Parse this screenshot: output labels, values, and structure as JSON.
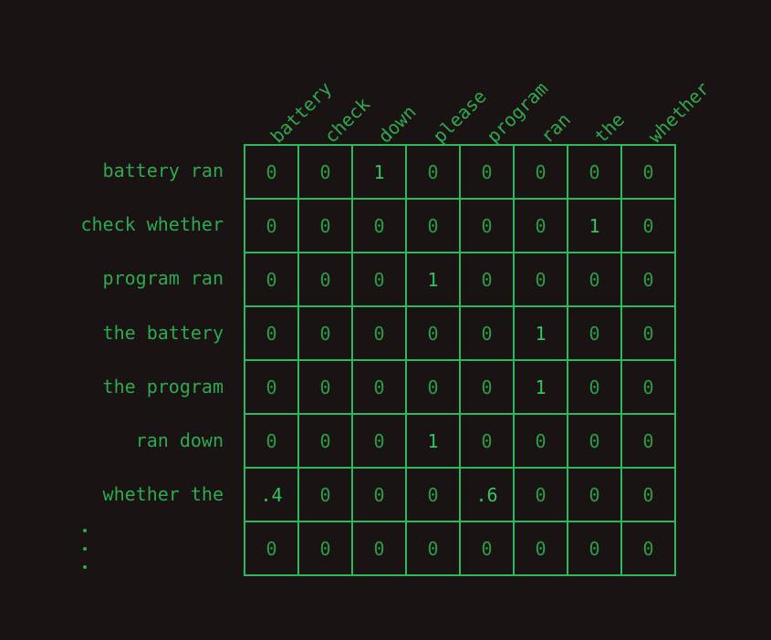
{
  "figure": {
    "name": "attention-alignment-matrix",
    "background_color": "#191313",
    "grid_color": "#2eb85c",
    "text_color": "#2fa94f"
  },
  "columns": [
    "battery",
    "check",
    "down",
    "please",
    "program",
    "ran",
    "the",
    "whether"
  ],
  "rows": [
    "battery ran",
    "check whether",
    "program ran",
    "the battery",
    "the program",
    "ran down",
    "whether the",
    "⋮"
  ],
  "chart_data": {
    "type": "heatmap",
    "title": "",
    "xlabel": "",
    "ylabel": "",
    "categories": [
      "battery",
      "check",
      "down",
      "please",
      "program",
      "ran",
      "the",
      "whether"
    ],
    "row_labels": [
      "battery ran",
      "check whether",
      "program ran",
      "the battery",
      "the program",
      "ran down",
      "whether the",
      "⋮"
    ],
    "values": [
      [
        "0",
        "0",
        "1",
        "0",
        "0",
        "0",
        "0",
        "0"
      ],
      [
        "0",
        "0",
        "0",
        "0",
        "0",
        "0",
        "1",
        "0"
      ],
      [
        "0",
        "0",
        "0",
        "1",
        "0",
        "0",
        "0",
        "0"
      ],
      [
        "0",
        "0",
        "0",
        "0",
        "0",
        "1",
        "0",
        "0"
      ],
      [
        "0",
        "0",
        "0",
        "0",
        "0",
        "1",
        "0",
        "0"
      ],
      [
        "0",
        "0",
        "0",
        "1",
        "0",
        "0",
        "0",
        "0"
      ],
      [
        ".4",
        "0",
        "0",
        "0",
        ".6",
        "0",
        "0",
        "0"
      ],
      [
        "0",
        "0",
        "0",
        "0",
        "0",
        "0",
        "0",
        "0"
      ]
    ],
    "grid": true,
    "legend": "none"
  }
}
